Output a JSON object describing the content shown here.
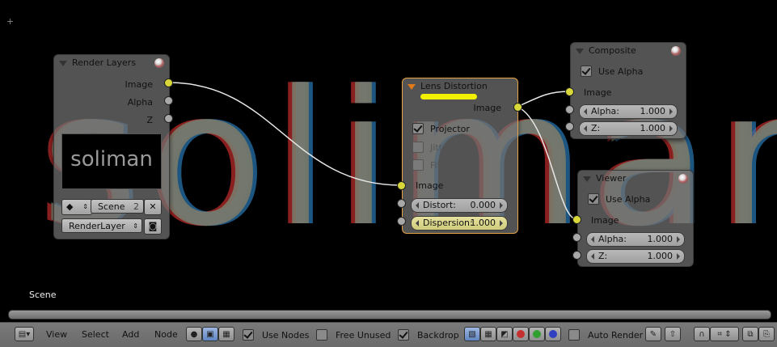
{
  "backdrop": {
    "text": "soliman"
  },
  "editor": {
    "scene_label": "Scene"
  },
  "nodes": {
    "render_layers": {
      "title": "Render Layers",
      "outputs": [
        "Image",
        "Alpha",
        "Z"
      ],
      "preview_text": "soliman",
      "scene_name": "Scene",
      "scene_users": "2",
      "layer_name": "RenderLayer"
    },
    "lens_distortion": {
      "title": "Lens Distortion",
      "output": "Image",
      "projector_label": "Projector",
      "jitter_label": "Jitter",
      "fit_label": "Fit",
      "input_image": "Image",
      "distort": {
        "label": "Distort:",
        "value": "0.000"
      },
      "dispersion": {
        "label": "Dispersion:",
        "value": "1.000"
      }
    },
    "composite": {
      "title": "Composite",
      "use_alpha_label": "Use Alpha",
      "image_label": "Image",
      "alpha": {
        "label": "Alpha:",
        "value": "1.000"
      },
      "z": {
        "label": "Z:",
        "value": "1.000"
      }
    },
    "viewer": {
      "title": "Viewer",
      "use_alpha_label": "Use Alpha",
      "image_label": "Image",
      "alpha": {
        "label": "Alpha:",
        "value": "1.000"
      },
      "z": {
        "label": "Z:",
        "value": "1.000"
      }
    }
  },
  "header": {
    "menus": [
      "View",
      "Select",
      "Add",
      "Node"
    ],
    "use_nodes_label": "Use Nodes",
    "free_unused_label": "Free Unused",
    "backdrop_label": "Backdrop",
    "auto_render_label": "Auto Render"
  },
  "colors": {
    "socket_yellow": "#d8d83a",
    "socket_grey": "#a8a8a8",
    "active_border": "#e6a44a",
    "highlight_bar": "#f0f000"
  }
}
